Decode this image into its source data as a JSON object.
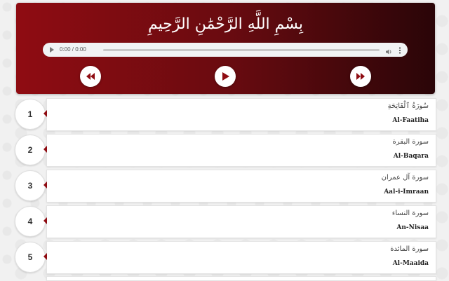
{
  "header": {
    "bismillah": "بِسْمِ اللَّهِ الرَّحْمَٰنِ الرَّحِيمِ",
    "accent_color": "#8f0c12"
  },
  "player": {
    "time": "0:00 / 0:00",
    "icons": [
      "play-icon",
      "volume-icon",
      "more-vertical-icon"
    ]
  },
  "controls": {
    "icons": [
      "rewind-icon",
      "play-icon",
      "fast-forward-icon"
    ]
  },
  "surahs": [
    {
      "number": "1",
      "arabic": "سُورَةُ ٱلْفَاتِحَةِ",
      "name": "Al-Faatiha"
    },
    {
      "number": "2",
      "arabic": "سورة البقرة",
      "name": "Al-Baqara"
    },
    {
      "number": "3",
      "arabic": "سورة آل عمران",
      "name": "Aal-i-Imraan"
    },
    {
      "number": "4",
      "arabic": "سورة النساء",
      "name": "An-Nisaa"
    },
    {
      "number": "5",
      "arabic": "سورة المائدة",
      "name": "Al-Maaida"
    }
  ]
}
